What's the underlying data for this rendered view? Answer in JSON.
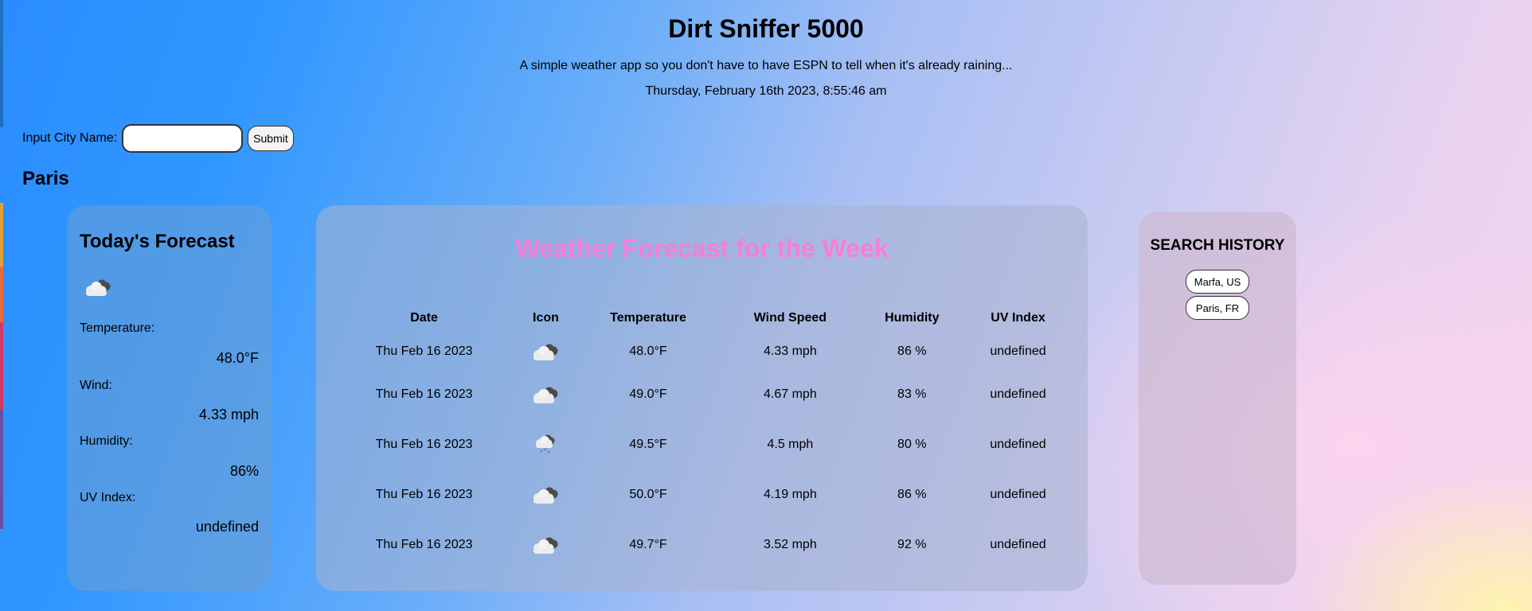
{
  "header": {
    "title": "Dirt Sniffer 5000",
    "subtitle": "A simple weather app so you don't have to have ESPN to tell when it's already raining...",
    "datetime": "Thursday, February 16th 2023, 8:55:46 am"
  },
  "search": {
    "label": "Input City Name:",
    "value": "",
    "placeholder": "",
    "submit_label": "Submit"
  },
  "city": "Paris",
  "today": {
    "title": "Today's Forecast",
    "icon": "cloud-night-icon",
    "temperature_label": "Temperature:",
    "temperature": "48.0°F",
    "wind_label": "Wind:",
    "wind": "4.33 mph",
    "humidity_label": "Humidity:",
    "humidity": "86%",
    "uv_label": "UV Index:",
    "uv": "undefined"
  },
  "week": {
    "title": "Weather Forecast for the Week",
    "title_color": "#f77ed8",
    "columns": [
      "Date",
      "Icon",
      "Temperature",
      "Wind Speed",
      "Humidity",
      "UV Index"
    ],
    "rows": [
      {
        "date": "Thu Feb 16 2023",
        "icon": "cloud-night-icon",
        "temp": "48.0°F",
        "wind": "4.33 mph",
        "humidity": "86 %",
        "uv": "undefined"
      },
      {
        "date": "Thu Feb 16 2023",
        "icon": "cloud-night-icon",
        "temp": "49.0°F",
        "wind": "4.67 mph",
        "humidity": "83 %",
        "uv": "undefined"
      },
      {
        "date": "Thu Feb 16 2023",
        "icon": "snow-cloud-night-icon",
        "temp": "49.5°F",
        "wind": "4.5 mph",
        "humidity": "80 %",
        "uv": "undefined"
      },
      {
        "date": "Thu Feb 16 2023",
        "icon": "cloud-night-icon",
        "temp": "50.0°F",
        "wind": "4.19 mph",
        "humidity": "86 %",
        "uv": "undefined"
      },
      {
        "date": "Thu Feb 16 2023",
        "icon": "cloud-night-icon",
        "temp": "49.7°F",
        "wind": "3.52 mph",
        "humidity": "92 %",
        "uv": "undefined"
      }
    ]
  },
  "history": {
    "title": "SEARCH HISTORY",
    "items": [
      "Marfa, US",
      "Paris, FR"
    ]
  }
}
